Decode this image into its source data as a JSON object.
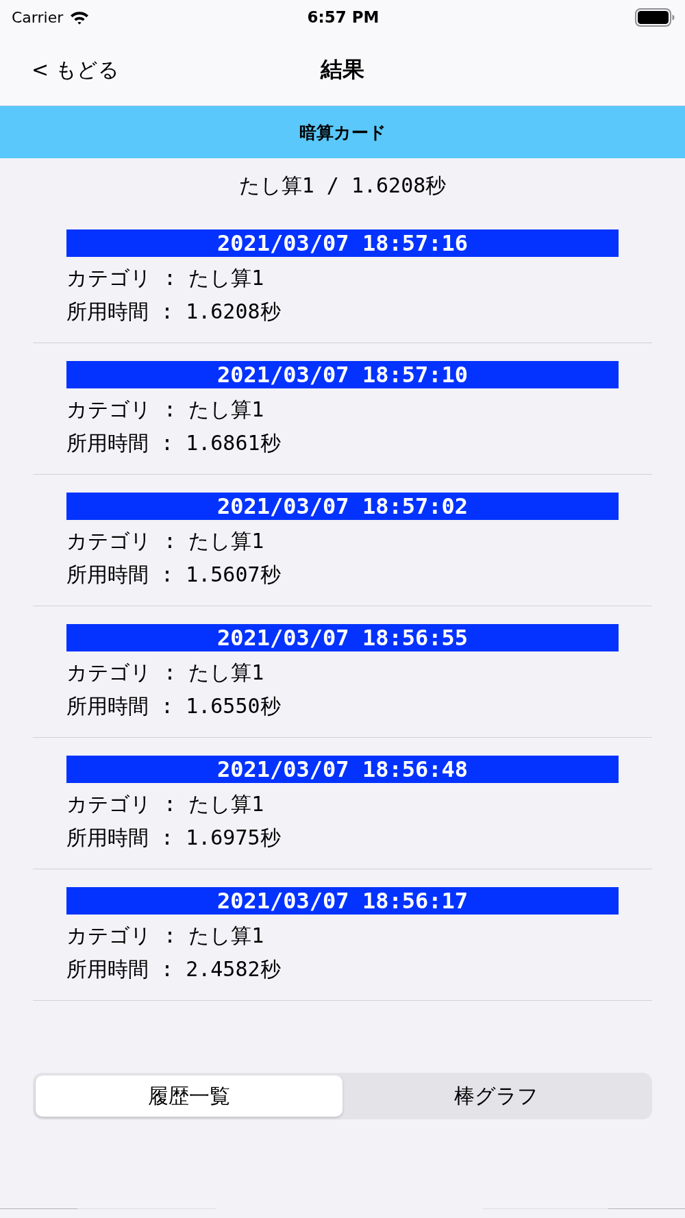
{
  "status_bar": {
    "carrier": "Carrier",
    "time": "6:57 PM"
  },
  "nav_bar": {
    "back": "< もどる",
    "title": "結果"
  },
  "banner": {
    "title": "暗算カード"
  },
  "summary": "たし算1 / 1.6208秒",
  "history": [
    {
      "timestamp": "2021/03/07 18:57:16",
      "category_line": "カテゴリ : たし算1",
      "duration_line": "所用時間 : 1.6208秒"
    },
    {
      "timestamp": "2021/03/07 18:57:10",
      "category_line": "カテゴリ : たし算1",
      "duration_line": "所用時間 : 1.6861秒"
    },
    {
      "timestamp": "2021/03/07 18:57:02",
      "category_line": "カテゴリ : たし算1",
      "duration_line": "所用時間 : 1.5607秒"
    },
    {
      "timestamp": "2021/03/07 18:56:55",
      "category_line": "カテゴリ : たし算1",
      "duration_line": "所用時間 : 1.6550秒"
    },
    {
      "timestamp": "2021/03/07 18:56:48",
      "category_line": "カテゴリ : たし算1",
      "duration_line": "所用時間 : 1.6975秒"
    },
    {
      "timestamp": "2021/03/07 18:56:17",
      "category_line": "カテゴリ : たし算1",
      "duration_line": "所用時間 : 2.4582秒"
    }
  ],
  "segmented_control": [
    {
      "label": "履歴一覧",
      "selected": true
    },
    {
      "label": "棒グラフ",
      "selected": false
    }
  ]
}
